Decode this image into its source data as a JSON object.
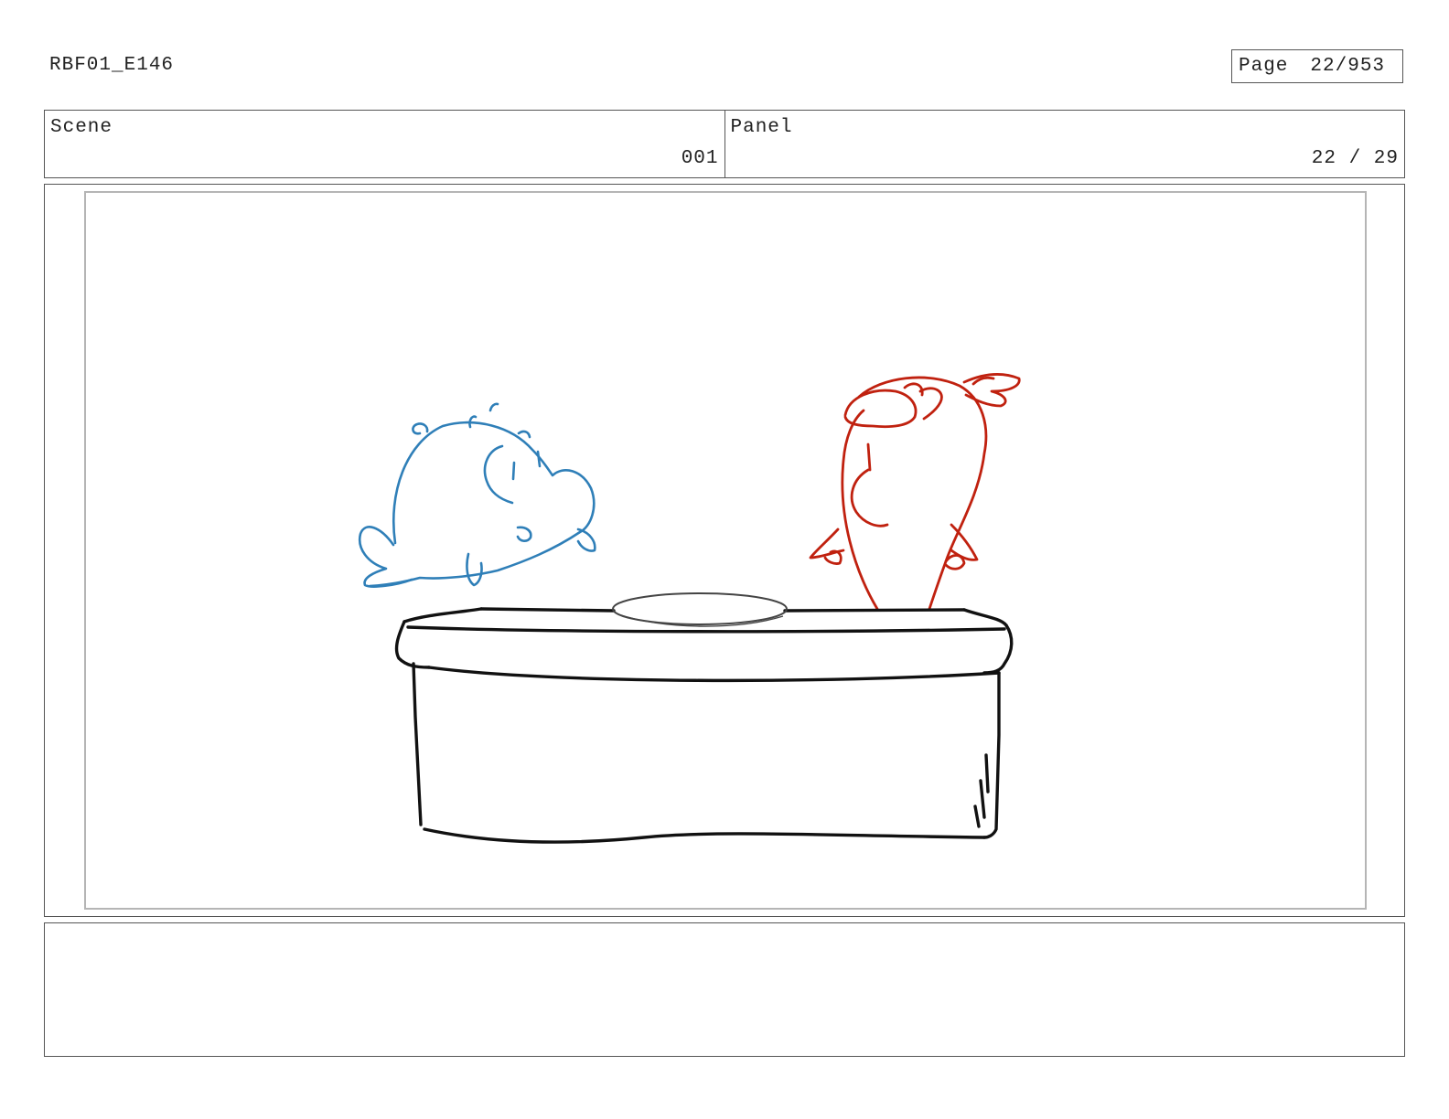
{
  "header": {
    "production_code": "RBF01_E146",
    "page_label": "Page",
    "page_number": "22/953"
  },
  "info": {
    "scene_label": "Scene",
    "scene_value": "001",
    "panel_label": "Panel",
    "panel_value": "22 / 29"
  },
  "drawing": {
    "blue_character_color": "#2f7fb8",
    "red_character_color": "#c0210f",
    "counter_color": "#111111"
  },
  "notes": {
    "text": ""
  }
}
